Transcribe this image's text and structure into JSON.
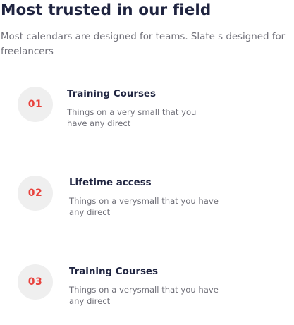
{
  "section": {
    "title": "Most trusted in our field",
    "subtitle": "Most calendars are designed for teams. Slate s designed for freelancers"
  },
  "features": [
    {
      "number": "01",
      "title": "Training Courses",
      "description": "Things on a very small that you have any direct"
    },
    {
      "number": "02",
      "title": "Lifetime access",
      "description": "Things on a verysmall that you have any direct"
    },
    {
      "number": "03",
      "title": "Training Courses",
      "description": "Things on a verysmall that you have any direct"
    }
  ],
  "colors": {
    "heading": "#1f2440",
    "body_text": "#6f6f78",
    "badge_background": "#efefef",
    "badge_number": "#e8423d"
  }
}
